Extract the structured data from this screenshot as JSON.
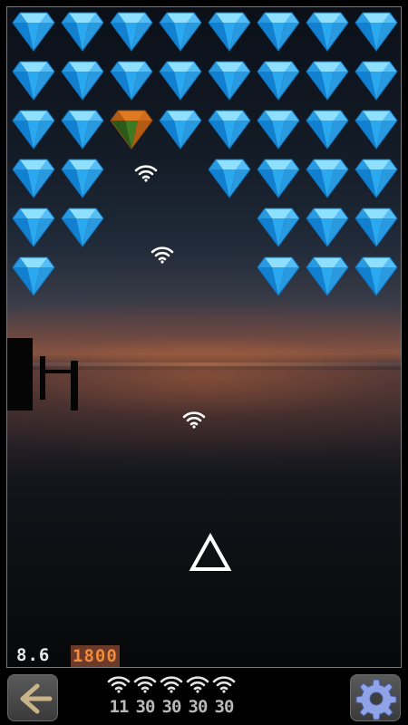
{
  "hud": {
    "time": "8.6",
    "score": "1800"
  },
  "ammo": [
    {
      "icon": "wifi-icon",
      "count": "11"
    },
    {
      "icon": "wifi-icon",
      "count": "30"
    },
    {
      "icon": "wifi-icon",
      "count": "30"
    },
    {
      "icon": "wifi-icon",
      "count": "30"
    },
    {
      "icon": "wifi-icon",
      "count": "30"
    }
  ],
  "controls": {
    "back_icon": "arrow-left-icon",
    "settings_icon": "gear-icon"
  },
  "colors": {
    "gem_blue": "#2aa9f0",
    "gem_special": "#c0601a",
    "score_text": "#f08c3a",
    "score_bg": "#6b3a28"
  },
  "gem_grid": {
    "rows": [
      [
        "blue",
        "blue",
        "blue",
        "blue",
        "blue",
        "blue",
        "blue",
        "blue"
      ],
      [
        "blue",
        "blue",
        "blue",
        "blue",
        "blue",
        "blue",
        "blue",
        "blue"
      ],
      [
        "blue",
        "blue",
        "orange",
        "blue",
        "blue",
        "blue",
        "blue",
        "blue"
      ],
      [
        "blue",
        "blue",
        "",
        "",
        "blue",
        "blue",
        "blue",
        "blue"
      ],
      [
        "blue",
        "blue",
        "",
        "",
        "",
        "blue",
        "blue",
        "blue"
      ],
      [
        "blue",
        "",
        "",
        "",
        "",
        "blue",
        "blue",
        "blue"
      ]
    ]
  },
  "projectiles": [
    {
      "type": "wifi-icon"
    },
    {
      "type": "wifi-icon"
    },
    {
      "type": "wifi-icon"
    }
  ],
  "player": {
    "icon": "triangle-ship-icon"
  }
}
